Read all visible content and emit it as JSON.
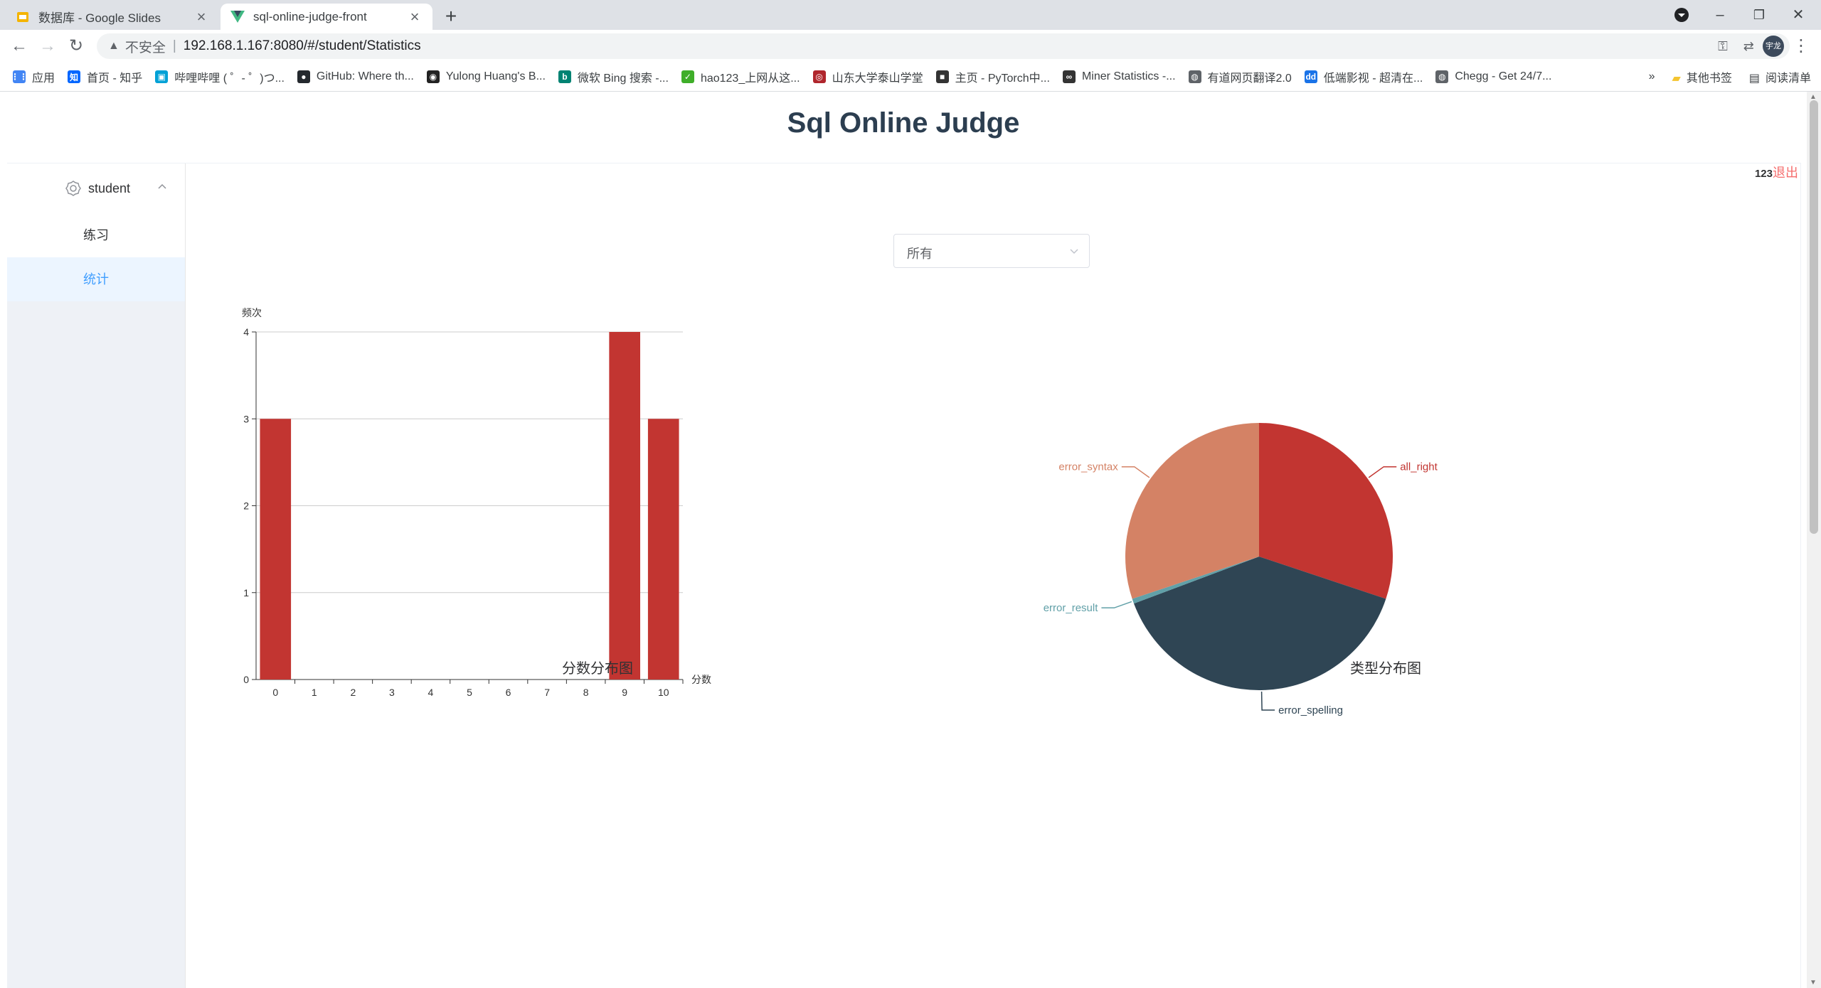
{
  "browser": {
    "tabs": [
      {
        "title": "数据库 - Google Slides",
        "active": false
      },
      {
        "title": "sql-online-judge-front",
        "active": true
      }
    ],
    "address": {
      "security": "不安全",
      "url": "192.168.1.167:8080/#/student/Statistics"
    },
    "profile_label": "宇龙",
    "bookmarks": [
      {
        "label": "应用",
        "icon": "apps-grid-icon",
        "color": "#4285f4"
      },
      {
        "label": "首页 - 知乎",
        "icon": "zhihu-icon",
        "color": "#0066ff"
      },
      {
        "label": "哔哩哔哩 ( ゜- ゜)つ...",
        "icon": "bilibili-icon",
        "color": "#00a1d6"
      },
      {
        "label": "GitHub: Where th...",
        "icon": "github-icon",
        "color": "#24292e"
      },
      {
        "label": "Yulong Huang's B...",
        "icon": "blog-icon",
        "color": "#222222"
      },
      {
        "label": "微软 Bing 搜索 -...",
        "icon": "bing-icon",
        "color": "#008373"
      },
      {
        "label": "hao123_上网从这...",
        "icon": "hao123-icon",
        "color": "#3fae29"
      },
      {
        "label": "山东大学泰山学堂",
        "icon": "sdu-icon",
        "color": "#b0262d"
      },
      {
        "label": "主页 - PyTorch中...",
        "icon": "book-icon",
        "color": "#333333"
      },
      {
        "label": "Miner Statistics -...",
        "icon": "miner-icon",
        "color": "#333333"
      },
      {
        "label": "有道网页翻译2.0",
        "icon": "globe-icon",
        "color": "#5f6368"
      },
      {
        "label": "低端影视 - 超清在...",
        "icon": "dd-icon",
        "color": "#1a73e8"
      },
      {
        "label": "Chegg - Get 24/7...",
        "icon": "globe-icon",
        "color": "#5f6368"
      }
    ],
    "bookmarks_right": {
      "more": "»",
      "other": "其他书签",
      "reading": "阅读清单"
    }
  },
  "page": {
    "title": "Sql Online Judge",
    "user": {
      "name": "123",
      "logout": "退出"
    },
    "sidebar": {
      "group_label": "student",
      "items": [
        {
          "label": "练习",
          "active": false
        },
        {
          "label": "统计",
          "active": true
        }
      ]
    },
    "filter": {
      "selected": "所有"
    }
  },
  "chart_data": [
    {
      "type": "bar",
      "title": "分数分布图",
      "xlabel": "分数",
      "ylabel": "频次",
      "categories": [
        "0",
        "1",
        "2",
        "3",
        "4",
        "5",
        "6",
        "7",
        "8",
        "9",
        "10"
      ],
      "values": [
        3,
        0,
        0,
        0,
        0,
        0,
        0,
        0,
        0,
        4,
        3
      ],
      "ylim": [
        0,
        4
      ],
      "yticks": [
        0,
        1,
        2,
        3,
        4
      ],
      "color": "#c23531",
      "grid": true
    },
    {
      "type": "pie",
      "title": "类型分布图",
      "slices": [
        {
          "name": "all_right",
          "value": 1,
          "color": "#c23531"
        },
        {
          "name": "error_spelling",
          "value": 1.3,
          "color": "#2f4554"
        },
        {
          "name": "error_result",
          "value": 0.02,
          "color": "#61a0a8"
        },
        {
          "name": "error_syntax",
          "value": 1,
          "color": "#d48265"
        }
      ]
    }
  ]
}
